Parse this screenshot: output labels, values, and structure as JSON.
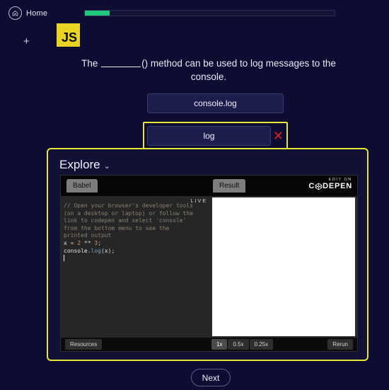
{
  "topbar": {
    "home_label": "Home",
    "home_icon": "home-circle-icon",
    "progress_percent": 10
  },
  "rail": {
    "add_label": "+"
  },
  "question": {
    "badge": "JS",
    "text_before": "The ",
    "text_after": "() method can be used to log messages to the console."
  },
  "answers": {
    "options": [
      {
        "label": "console.log",
        "selected": false,
        "marked_wrong": false
      },
      {
        "label": "log",
        "selected": true,
        "marked_wrong": true
      }
    ],
    "wrong_icon": "✕"
  },
  "explore": {
    "title": "Explore",
    "chevron": "⌄"
  },
  "codepen": {
    "tab_left": "Babel",
    "tab_right": "Result",
    "edit_on_small": "EDIT ON",
    "edit_on_brand_left": "C",
    "edit_on_brand_right": "DEPEN",
    "live_label": "LIVE",
    "code": {
      "comment_lines": [
        "// Open your browser's developer tools",
        "(on a desktop or laptop) or follow the",
        "link to codepen and select 'console'",
        "from the bottom menu to see the",
        "printed output"
      ],
      "line_assign": {
        "var": "x",
        "eq": " = ",
        "num1": "2",
        "op": " ** ",
        "num2": "3",
        "semi": ";"
      },
      "line_log": {
        "obj": "console",
        "dot": ".",
        "prop": "log",
        "open": "(",
        "arg": "x",
        "close": ")",
        "semi": ";"
      }
    },
    "footer": {
      "resources": "Resources",
      "zoom_levels": [
        "1x",
        "0.5x",
        "0.25x"
      ],
      "active_zoom": "1x",
      "rerun": "Rerun"
    }
  },
  "footer": {
    "next_label": "Next"
  },
  "colors": {
    "background": "#0d0d33",
    "accent_yellow": "#e8e53a",
    "progress_green": "#22c97c",
    "js_yellow": "#e9d424",
    "wrong_red": "#e02020"
  }
}
